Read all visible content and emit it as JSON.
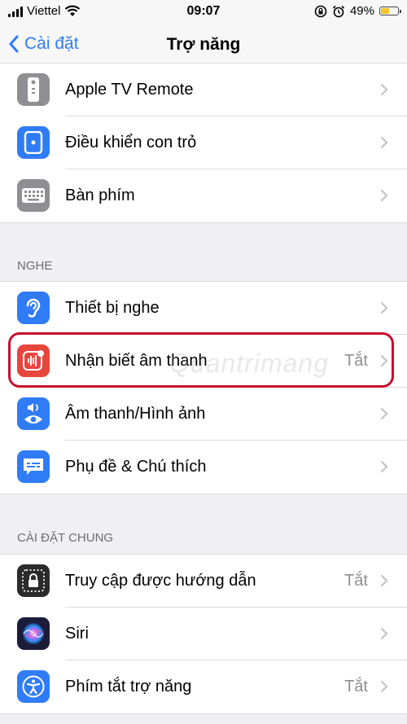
{
  "status_bar": {
    "carrier": "Viettel",
    "time": "09:07",
    "battery": "49%",
    "battery_level": 0.49
  },
  "nav": {
    "back_label": "Cài đặt",
    "title": "Trợ năng"
  },
  "groups": [
    {
      "rows": [
        {
          "label": "Apple TV Remote",
          "value": "",
          "icon": "tv-remote-icon",
          "color": "#8e8e93"
        },
        {
          "label": "Điều khiển con trỏ",
          "value": "",
          "icon": "pointer-control-icon",
          "color": "#2f7cf6"
        },
        {
          "label": "Bàn phím",
          "value": "",
          "icon": "keyboard-icon",
          "color": "#8e8e93"
        }
      ]
    },
    {
      "header": "NGHE",
      "rows": [
        {
          "label": "Thiết bị nghe",
          "value": "",
          "icon": "ear-icon",
          "color": "#2f7cf6"
        },
        {
          "label": "Nhận biết âm thanh",
          "value": "Tắt",
          "icon": "sound-recognition-icon",
          "color": "#e8453c"
        },
        {
          "label": "Âm thanh/Hình ảnh",
          "value": "",
          "icon": "audio-visual-icon",
          "color": "#2f7cf6"
        },
        {
          "label": "Phụ đề & Chú thích",
          "value": "",
          "icon": "subtitles-icon",
          "color": "#2f7cf6"
        }
      ]
    },
    {
      "header": "CÀI ĐẶT CHUNG",
      "rows": [
        {
          "label": "Truy cập được hướng dẫn",
          "value": "Tắt",
          "icon": "guided-access-icon",
          "color": "#2b2b2b"
        },
        {
          "label": "Siri",
          "value": "",
          "icon": "siri-icon",
          "color": "#1b1b3a"
        },
        {
          "label": "Phím tắt trợ năng",
          "value": "Tắt",
          "icon": "accessibility-shortcut-icon",
          "color": "#2f7cf6"
        }
      ]
    }
  ],
  "watermark": "Quantrimang"
}
